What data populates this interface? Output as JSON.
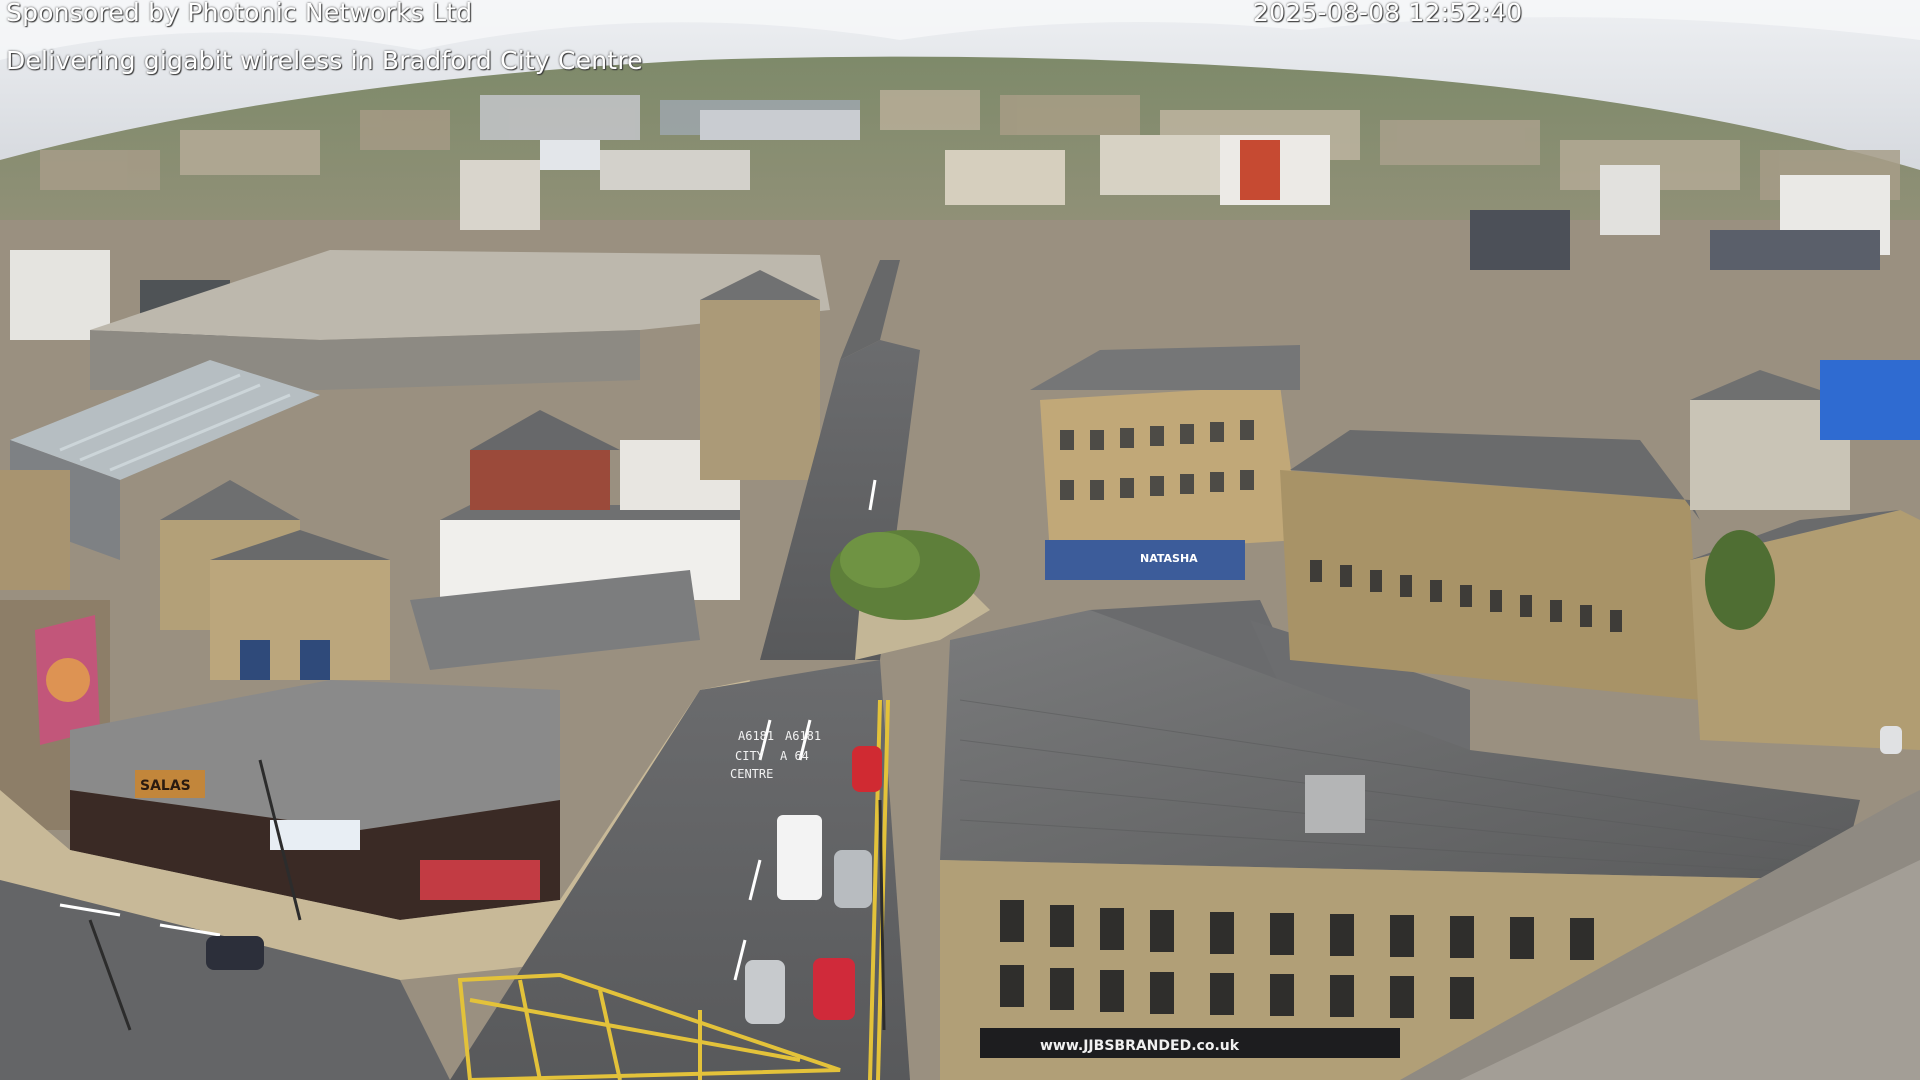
{
  "overlay": {
    "sponsor": "Sponsored by Photonic Networks Ltd",
    "tagline": "Delivering gigabit wireless in Bradford City Centre",
    "timestamp": "2025-08-08 12:52:40"
  },
  "scene_labels": {
    "road_marking_left": "A6181",
    "road_marking_right": "A6181",
    "road_marking_city": "CITY",
    "road_marking_centre": "CENTRE",
    "road_marking_a64": "A 64",
    "shop_sign_salas": "SALAS",
    "shop_sign_natasha": "NATASHA",
    "shop_sign_url": "www.JJBSBRANDED.co.uk"
  },
  "colors": {
    "sky": "#d9dde3",
    "road": "#5f6062",
    "sandstone": "#b39f72",
    "roof_slate": "#6d6e6f",
    "tree": "#5e7f3a",
    "yellow_lines": "#e3c23a"
  }
}
